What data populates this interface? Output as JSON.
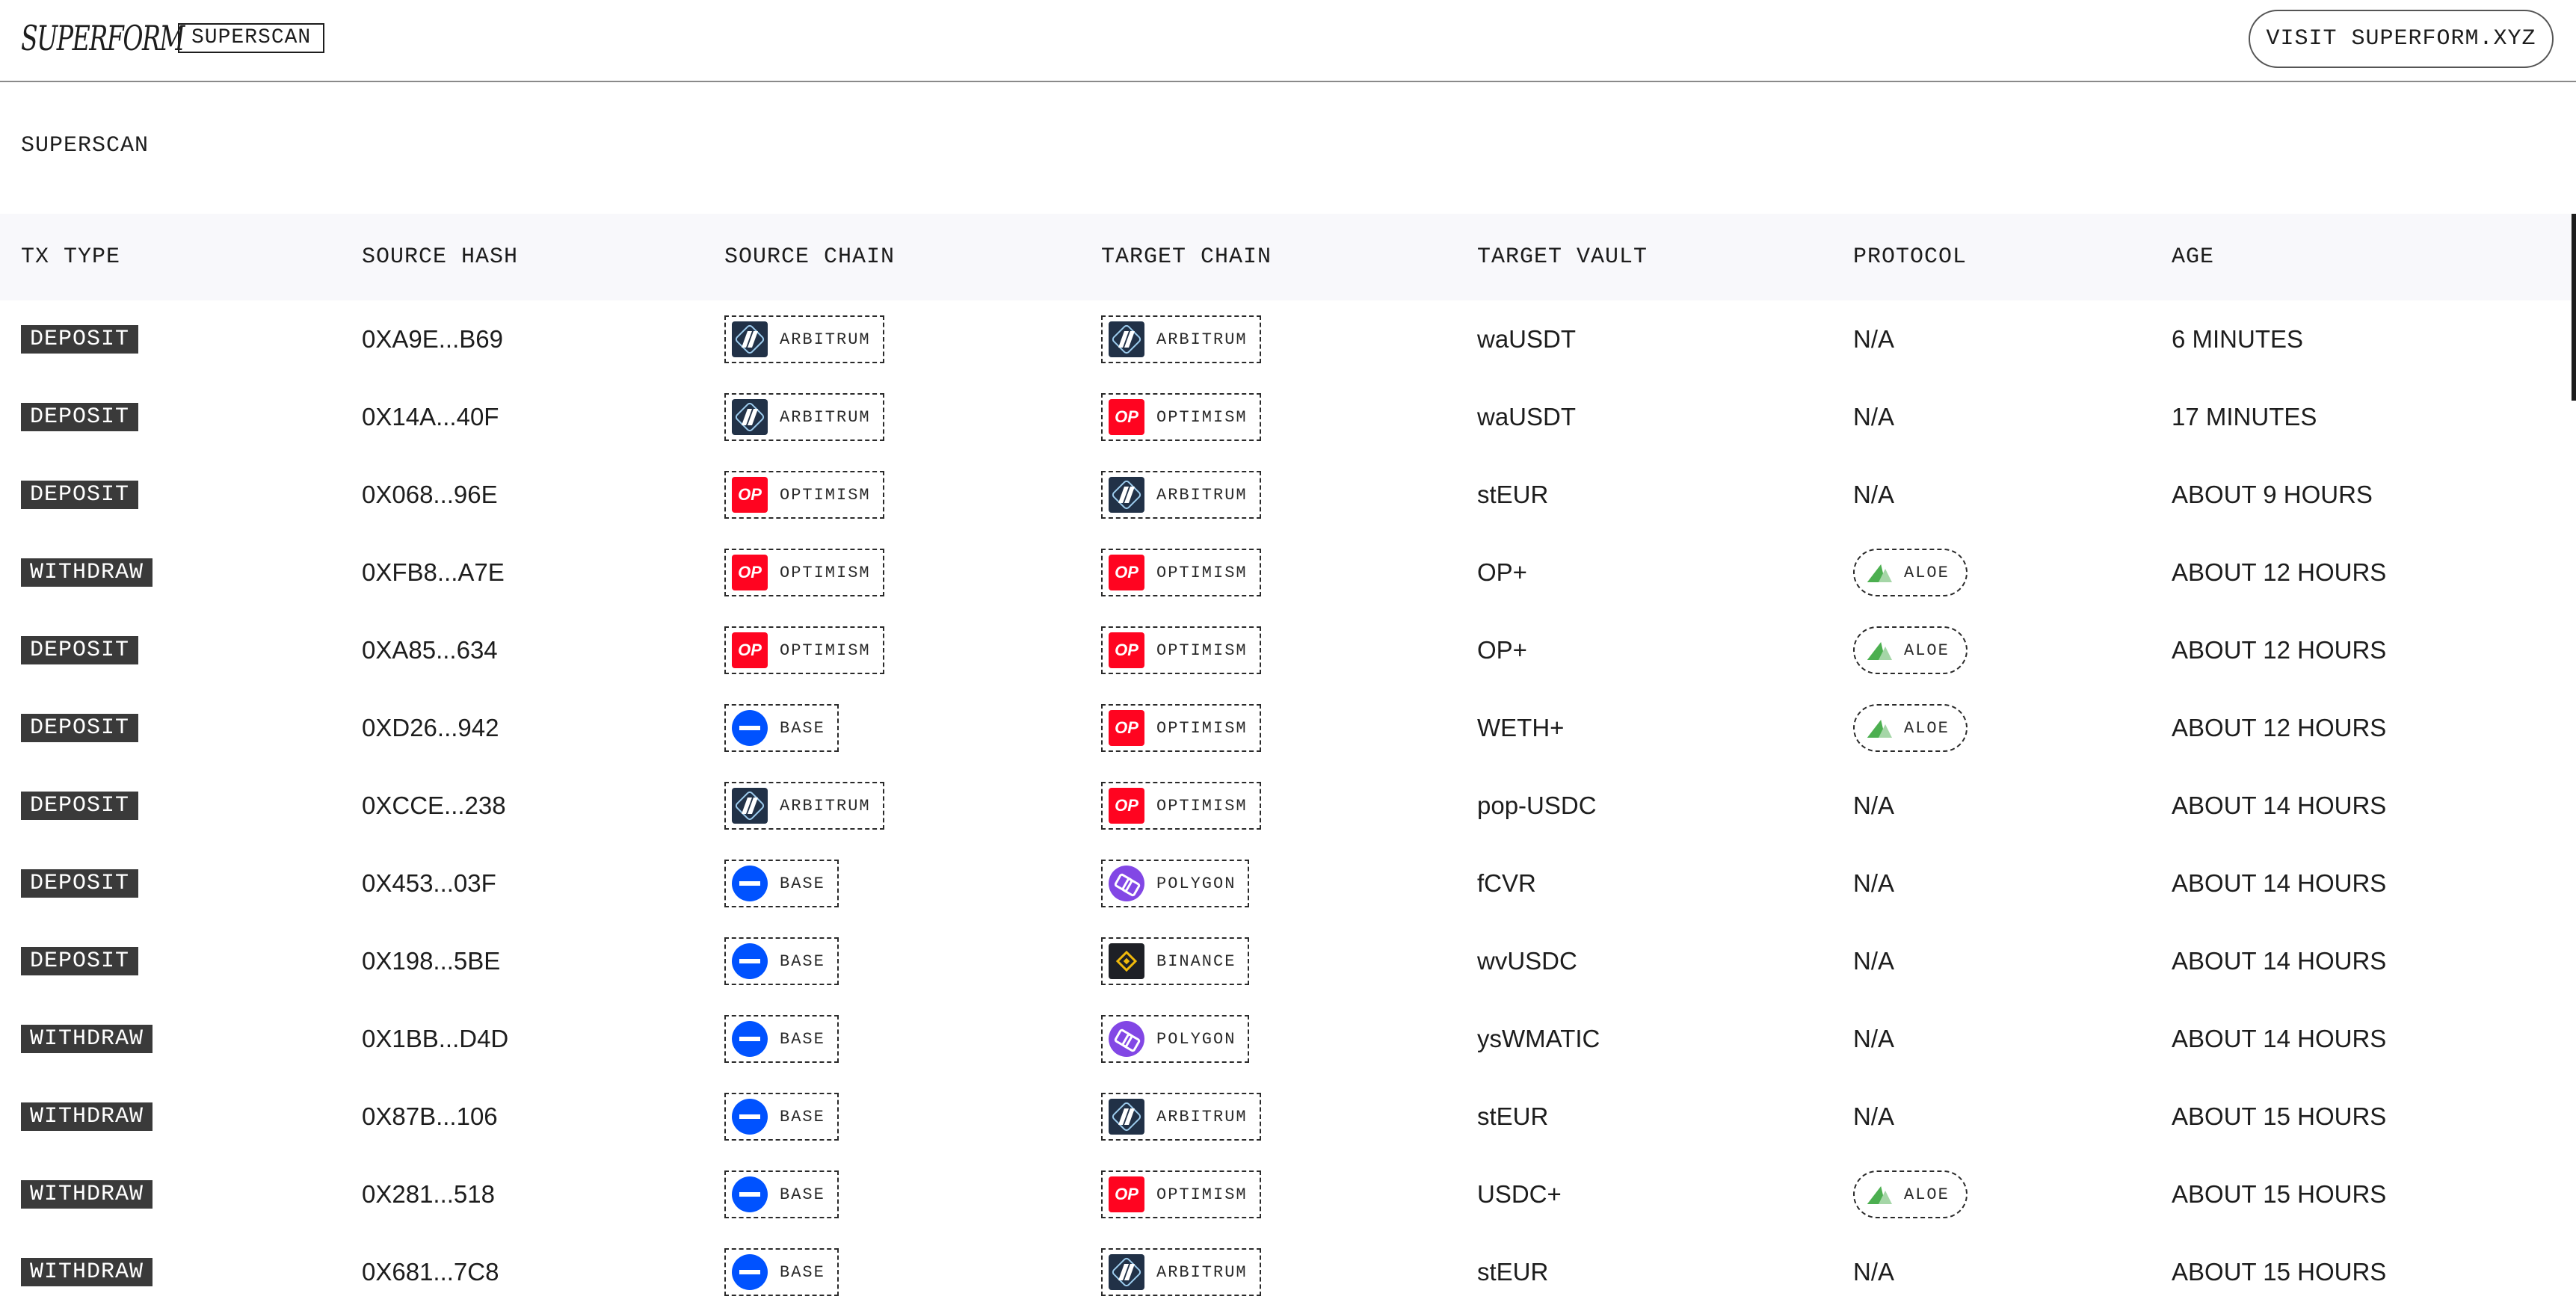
{
  "header": {
    "logo": "SUPERFORM",
    "brand_tag": "SUPERSCAN",
    "visit_button": "VISIT SUPERFORM.XYZ"
  },
  "page": {
    "heading": "SUPERSCAN"
  },
  "table": {
    "columns": [
      "TX TYPE",
      "SOURCE HASH",
      "SOURCE CHAIN",
      "TARGET CHAIN",
      "TARGET VAULT",
      "PROTOCOL",
      "AGE"
    ],
    "rows": [
      {
        "tx_type": "DEPOSIT",
        "hash": "0XA9E...B69",
        "source_chain": {
          "name": "ARBITRUM",
          "icon": "arbitrum-icon"
        },
        "target_chain": {
          "name": "ARBITRUM",
          "icon": "arbitrum-icon"
        },
        "vault": "waUSDT",
        "protocol": "N/A",
        "age": "6 MINUTES"
      },
      {
        "tx_type": "DEPOSIT",
        "hash": "0X14A...40F",
        "source_chain": {
          "name": "ARBITRUM",
          "icon": "arbitrum-icon"
        },
        "target_chain": {
          "name": "OPTIMISM",
          "icon": "optimism-icon"
        },
        "vault": "waUSDT",
        "protocol": "N/A",
        "age": "17 MINUTES"
      },
      {
        "tx_type": "DEPOSIT",
        "hash": "0X068...96E",
        "source_chain": {
          "name": "OPTIMISM",
          "icon": "optimism-icon"
        },
        "target_chain": {
          "name": "ARBITRUM",
          "icon": "arbitrum-icon"
        },
        "vault": "stEUR",
        "protocol": "N/A",
        "age": "ABOUT 9 HOURS"
      },
      {
        "tx_type": "WITHDRAW",
        "hash": "0XFB8...A7E",
        "source_chain": {
          "name": "OPTIMISM",
          "icon": "optimism-icon"
        },
        "target_chain": {
          "name": "OPTIMISM",
          "icon": "optimism-icon"
        },
        "vault": "OP+",
        "protocol": "ALOE",
        "age": "ABOUT 12 HOURS"
      },
      {
        "tx_type": "DEPOSIT",
        "hash": "0XA85...634",
        "source_chain": {
          "name": "OPTIMISM",
          "icon": "optimism-icon"
        },
        "target_chain": {
          "name": "OPTIMISM",
          "icon": "optimism-icon"
        },
        "vault": "OP+",
        "protocol": "ALOE",
        "age": "ABOUT 12 HOURS"
      },
      {
        "tx_type": "DEPOSIT",
        "hash": "0XD26...942",
        "source_chain": {
          "name": "BASE",
          "icon": "base-icon"
        },
        "target_chain": {
          "name": "OPTIMISM",
          "icon": "optimism-icon"
        },
        "vault": "WETH+",
        "protocol": "ALOE",
        "age": "ABOUT 12 HOURS"
      },
      {
        "tx_type": "DEPOSIT",
        "hash": "0XCCE...238",
        "source_chain": {
          "name": "ARBITRUM",
          "icon": "arbitrum-icon"
        },
        "target_chain": {
          "name": "OPTIMISM",
          "icon": "optimism-icon"
        },
        "vault": "pop-USDC",
        "protocol": "N/A",
        "age": "ABOUT 14 HOURS"
      },
      {
        "tx_type": "DEPOSIT",
        "hash": "0X453...03F",
        "source_chain": {
          "name": "BASE",
          "icon": "base-icon"
        },
        "target_chain": {
          "name": "POLYGON",
          "icon": "polygon-icon"
        },
        "vault": "fCVR",
        "protocol": "N/A",
        "age": "ABOUT 14 HOURS"
      },
      {
        "tx_type": "DEPOSIT",
        "hash": "0X198...5BE",
        "source_chain": {
          "name": "BASE",
          "icon": "base-icon"
        },
        "target_chain": {
          "name": "BINANCE",
          "icon": "binance-icon"
        },
        "vault": "wvUSDC",
        "protocol": "N/A",
        "age": "ABOUT 14 HOURS"
      },
      {
        "tx_type": "WITHDRAW",
        "hash": "0X1BB...D4D",
        "source_chain": {
          "name": "BASE",
          "icon": "base-icon"
        },
        "target_chain": {
          "name": "POLYGON",
          "icon": "polygon-icon"
        },
        "vault": "ysWMATIC",
        "protocol": "N/A",
        "age": "ABOUT 14 HOURS"
      },
      {
        "tx_type": "WITHDRAW",
        "hash": "0X87B...106",
        "source_chain": {
          "name": "BASE",
          "icon": "base-icon"
        },
        "target_chain": {
          "name": "ARBITRUM",
          "icon": "arbitrum-icon"
        },
        "vault": "stEUR",
        "protocol": "N/A",
        "age": "ABOUT 15 HOURS"
      },
      {
        "tx_type": "WITHDRAW",
        "hash": "0X281...518",
        "source_chain": {
          "name": "BASE",
          "icon": "base-icon"
        },
        "target_chain": {
          "name": "OPTIMISM",
          "icon": "optimism-icon"
        },
        "vault": "USDC+",
        "protocol": "ALOE",
        "age": "ABOUT 15 HOURS"
      },
      {
        "tx_type": "WITHDRAW",
        "hash": "0X681...7C8",
        "source_chain": {
          "name": "BASE",
          "icon": "base-icon"
        },
        "target_chain": {
          "name": "ARBITRUM",
          "icon": "arbitrum-icon"
        },
        "vault": "stEUR",
        "protocol": "N/A",
        "age": "ABOUT 15 HOURS"
      }
    ]
  },
  "icons": {
    "arbitrum-icon": {
      "color": "#213147"
    },
    "optimism-icon": {
      "color": "#ff0420",
      "glyph": "OP"
    },
    "base-icon": {
      "color": "#0052ff"
    },
    "polygon-icon": {
      "color": "#8247e5"
    },
    "binance-icon": {
      "color": "#f0b90b"
    },
    "aloe-icon": {
      "color": "#4caf50"
    }
  }
}
